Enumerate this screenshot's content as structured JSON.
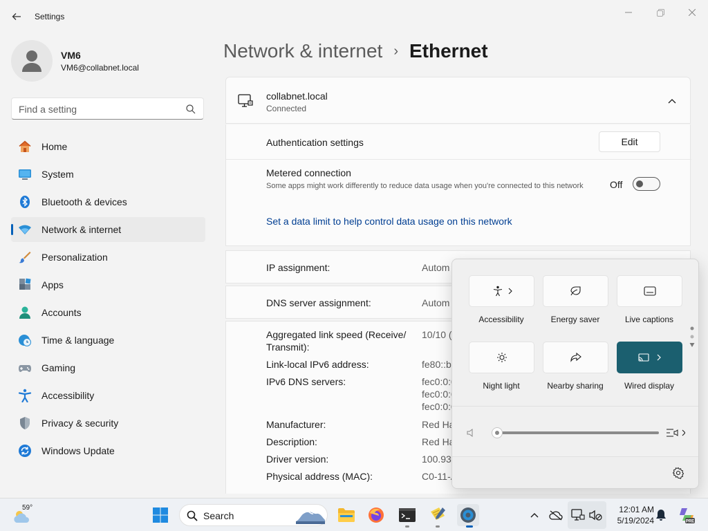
{
  "window": {
    "title": "Settings"
  },
  "profile": {
    "name": "VM6",
    "email": "VM6@collabnet.local"
  },
  "search": {
    "placeholder": "Find a setting"
  },
  "nav": {
    "items": [
      {
        "label": "Home",
        "icon": "home-icon"
      },
      {
        "label": "System",
        "icon": "system-icon"
      },
      {
        "label": "Bluetooth & devices",
        "icon": "bluetooth-icon"
      },
      {
        "label": "Network & internet",
        "icon": "wifi-icon",
        "active": true
      },
      {
        "label": "Personalization",
        "icon": "brush-icon"
      },
      {
        "label": "Apps",
        "icon": "apps-icon"
      },
      {
        "label": "Accounts",
        "icon": "accounts-icon"
      },
      {
        "label": "Time & language",
        "icon": "globe-clock-icon"
      },
      {
        "label": "Gaming",
        "icon": "gamepad-icon"
      },
      {
        "label": "Accessibility",
        "icon": "accessibility-icon"
      },
      {
        "label": "Privacy & security",
        "icon": "shield-icon"
      },
      {
        "label": "Windows Update",
        "icon": "update-icon"
      }
    ]
  },
  "breadcrumb": {
    "parent": "Network & internet",
    "separator": "›",
    "current": "Ethernet"
  },
  "connection": {
    "name": "collabnet.local",
    "status": "Connected",
    "auth_label": "Authentication settings",
    "edit_label": "Edit",
    "metered_title": "Metered connection",
    "metered_desc": "Some apps might work differently to reduce data usage when you're connected to this network",
    "metered_state": "Off",
    "metered_on": false,
    "data_limit_link": "Set a data limit to help control data usage on this network"
  },
  "ip": {
    "label": "IP assignment:",
    "value": "Autom"
  },
  "dns": {
    "label": "DNS server assignment:",
    "value": "Autom"
  },
  "properties": {
    "link_speed": {
      "label": "Aggregated link speed (Receive/ Transmit):",
      "value": "10/10 ("
    },
    "link_local": {
      "label": "Link-local IPv6 address:",
      "value": "fe80::b"
    },
    "ipv6_dns": {
      "label": "IPv6 DNS servers:",
      "values": [
        "fec0:0:0",
        "fec0:0:0",
        "fec0:0:0"
      ]
    },
    "manufacturer": {
      "label": "Manufacturer:",
      "value": "Red Ha"
    },
    "description": {
      "label": "Description:",
      "value": "Red Ha"
    },
    "driver": {
      "label": "Driver version:",
      "value": "100.93."
    },
    "mac": {
      "label": "Physical address (MAC):",
      "value": "C0-11-A"
    }
  },
  "quick_settings": {
    "tiles": [
      {
        "label": "Accessibility",
        "icon": "accessibility-icon",
        "active": false,
        "expandable": true
      },
      {
        "label": "Energy saver",
        "icon": "leaf-icon",
        "active": false,
        "expandable": false
      },
      {
        "label": "Live captions",
        "icon": "captions-icon",
        "active": false,
        "expandable": false
      },
      {
        "label": "Night light",
        "icon": "sun-icon",
        "active": false,
        "expandable": false
      },
      {
        "label": "Nearby sharing",
        "icon": "share-icon",
        "active": false,
        "expandable": false
      },
      {
        "label": "Wired display",
        "icon": "cast-icon",
        "active": true,
        "expandable": true
      }
    ],
    "volume_level": 0
  },
  "taskbar": {
    "weather_temp": "59°",
    "search_label": "Search",
    "clock_time": "12:01 AM",
    "clock_date": "5/19/2024"
  },
  "colors": {
    "accent": "#005fb8",
    "link": "#003e92",
    "active_tile": "#1b5f6f"
  }
}
